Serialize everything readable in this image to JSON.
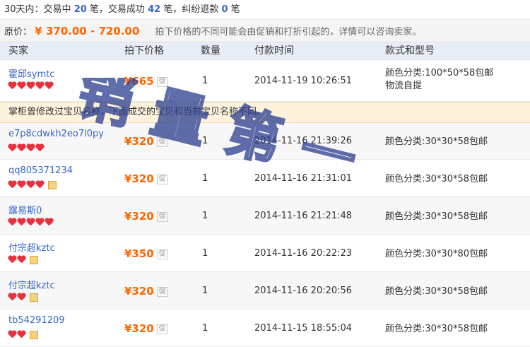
{
  "summary": {
    "prefix": "30天内：交易中",
    "trading_count": "20",
    "text1": "笔，交易成功",
    "success_count": "42",
    "text2": "笔，纠纷退款",
    "dispute_count": "0",
    "text3": "笔"
  },
  "price_bar": {
    "label": "原价：",
    "range": "¥ 370.00 - 720.00",
    "note": "拍下价格的不同可能会由促销和打折引起的，详情可以咨询卖家。"
  },
  "table": {
    "headers": [
      "买家",
      "拍下价格",
      "数量",
      "付款时间",
      "款式和型号"
    ],
    "promo_label": "促",
    "notice": "掌柜曾修改过宝贝名称，下面成交的宝贝和当前宝贝名称不同。",
    "rows": [
      {
        "buyer": "霍邱symtc",
        "hearts": 5,
        "badge": false,
        "price": "¥665",
        "qty": "1",
        "time": "2014-11-19 10:26:51",
        "spec": "颜色分类:100*50*58包邮",
        "spec2": "物流自提"
      },
      {
        "buyer": "e7p8cdwkh2eo7l0py",
        "hearts": 4,
        "badge": false,
        "price": "¥320",
        "qty": "1",
        "time": "2014-11-16 21:39:26",
        "spec": "颜色分类:30*30*58包邮",
        "spec2": ""
      },
      {
        "buyer": "qq805371234",
        "hearts": 4,
        "badge": true,
        "price": "¥320",
        "qty": "1",
        "time": "2014-11-16 21:31:01",
        "spec": "颜色分类:30*30*58包邮",
        "spec2": ""
      },
      {
        "buyer": "露易斯0",
        "hearts": 5,
        "badge": false,
        "price": "¥320",
        "qty": "1",
        "time": "2014-11-16 21:21:48",
        "spec": "颜色分类:30*30*58包邮",
        "spec2": ""
      },
      {
        "buyer": "付宗超kztc",
        "hearts": 2,
        "badge": true,
        "price": "¥350",
        "qty": "1",
        "time": "2014-11-16 20:22:23",
        "spec": "颜色分类:30*30*80包邮",
        "spec2": ""
      },
      {
        "buyer": "付宗超kztc",
        "hearts": 2,
        "badge": true,
        "price": "¥320",
        "qty": "1",
        "time": "2014-11-16 20:20:56",
        "spec": "颜色分类:30*30*58包邮",
        "spec2": ""
      },
      {
        "buyer": "tb54291209",
        "hearts": 2,
        "badge": true,
        "price": "¥320",
        "qty": "1",
        "time": "2014-11-15 18:55:04",
        "spec": "颜色分类:30*30*58包邮",
        "spec2": ""
      }
    ]
  },
  "watermark": {
    "text": "销量第一",
    "color": "#2a3d8f"
  }
}
